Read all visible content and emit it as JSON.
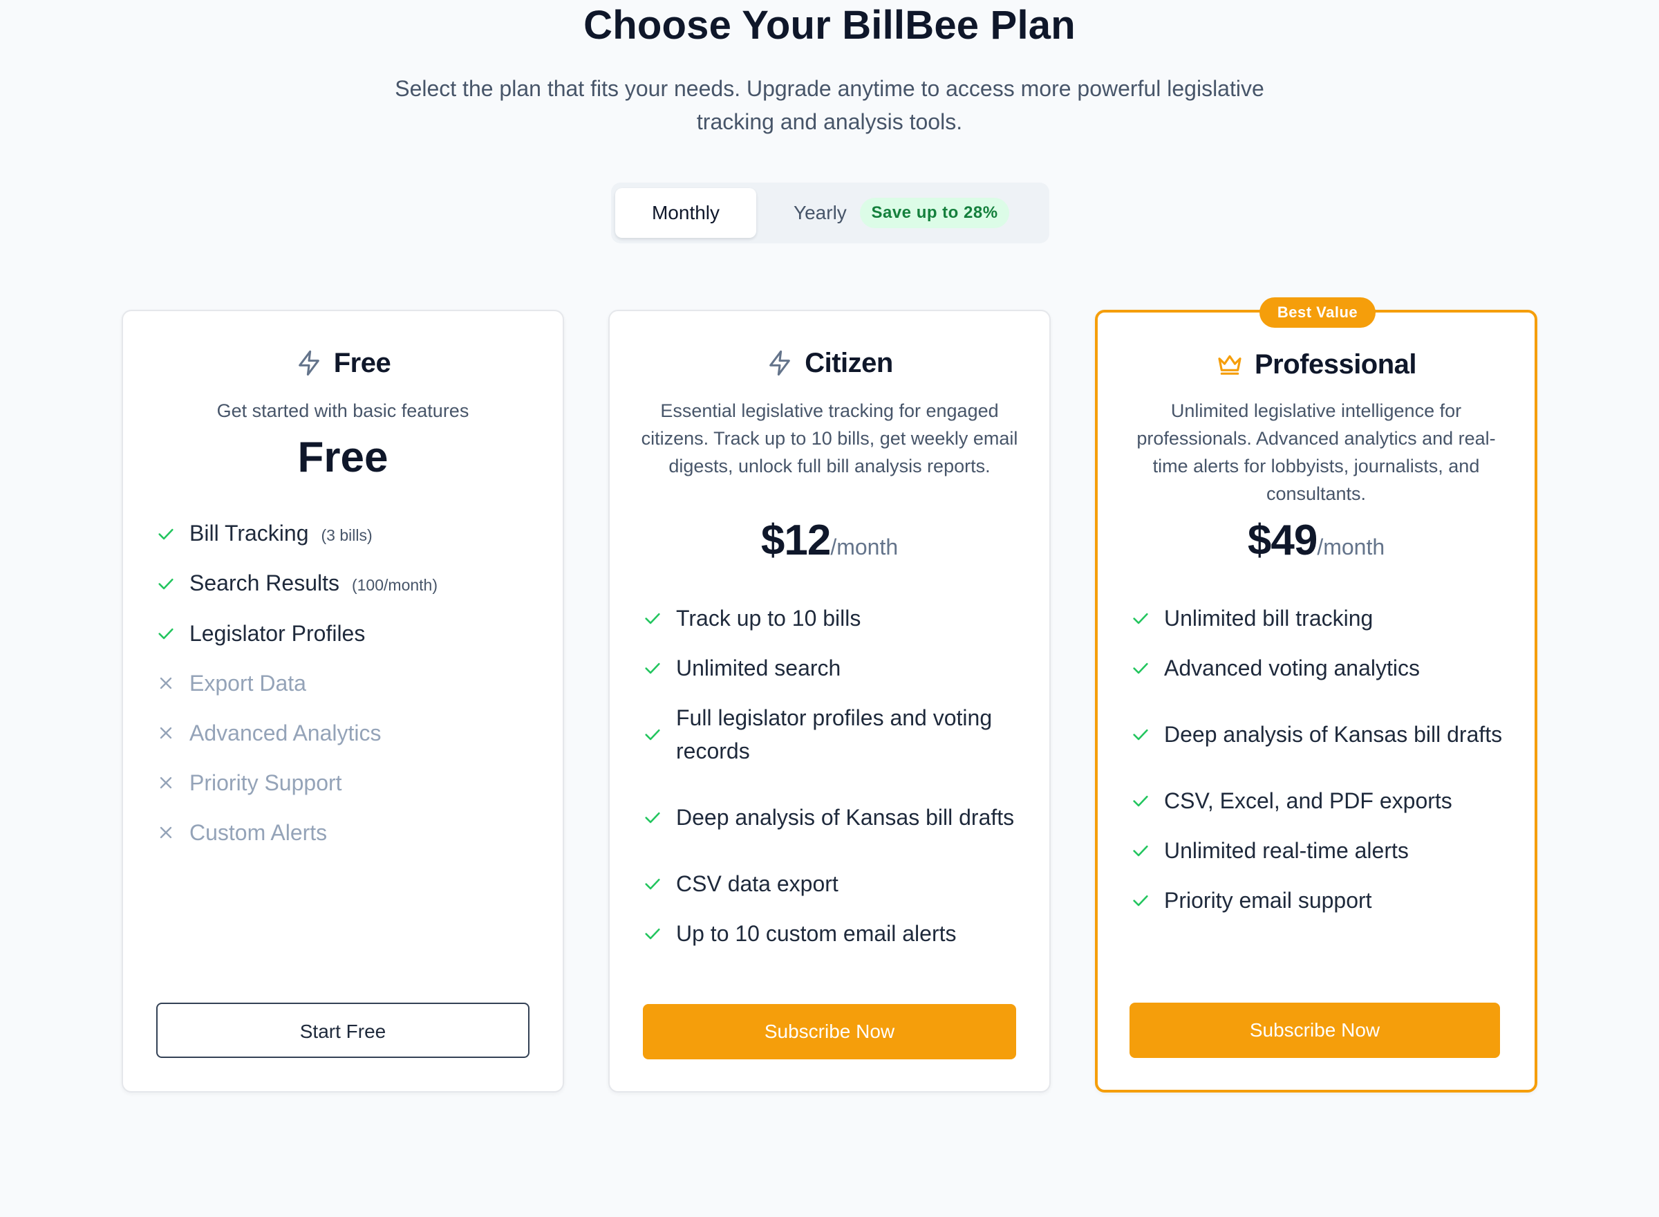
{
  "header": {
    "title": "Choose Your BillBee Plan",
    "subtitle": "Select the plan that fits your needs. Upgrade anytime to access more powerful legislative tracking and analysis tools."
  },
  "billing_toggle": {
    "monthly_label": "Monthly",
    "yearly_label": "Yearly",
    "save_badge": "Save up to 28%",
    "selected": "Monthly"
  },
  "colors": {
    "accent": "#f59e0b",
    "check": "#22c55e",
    "cross": "#94a3b8",
    "save_badge_bg": "#dcfce7",
    "save_badge_text": "#15803d"
  },
  "plans": [
    {
      "name": "Free",
      "icon": "lightning-icon",
      "description": "Get started with basic features",
      "price": "Free",
      "features": [
        {
          "label": "Bill Tracking",
          "note": "(3 bills)",
          "included": true
        },
        {
          "label": "Search Results",
          "note": "(100/month)",
          "included": true
        },
        {
          "label": "Legislator Profiles",
          "included": true
        },
        {
          "label": "Export Data",
          "included": false
        },
        {
          "label": "Advanced Analytics",
          "included": false
        },
        {
          "label": "Priority Support",
          "included": false
        },
        {
          "label": "Custom Alerts",
          "included": false
        }
      ],
      "button": "Start Free"
    },
    {
      "name": "Citizen",
      "icon": "lightning-icon",
      "description": "Essential legislative tracking for engaged citizens. Track up to 10 bills, get weekly email digests, unlock full bill analysis reports.",
      "price": "$12",
      "period": "/month",
      "features": [
        {
          "label": "Track up to 10 bills",
          "included": true
        },
        {
          "label": "Unlimited search",
          "included": true
        },
        {
          "label": "Full legislator profiles and voting records",
          "included": true
        },
        {
          "label": "Deep analysis of Kansas bill drafts",
          "included": true
        },
        {
          "label": "CSV data export",
          "included": true
        },
        {
          "label": "Up to 10 custom email alerts",
          "included": true
        }
      ],
      "button": "Subscribe Now"
    },
    {
      "name": "Professional",
      "icon": "crown-icon",
      "badge": "Best Value",
      "description": "Unlimited legislative intelligence for professionals. Advanced analytics and real-time alerts for lobbyists, journalists, and consultants.",
      "price": "$49",
      "period": "/month",
      "features": [
        {
          "label": "Unlimited bill tracking",
          "included": true
        },
        {
          "label": "Advanced voting analytics",
          "included": true
        },
        {
          "label": "Deep analysis of Kansas bill drafts",
          "included": true
        },
        {
          "label": "CSV, Excel, and PDF exports",
          "included": true
        },
        {
          "label": "Unlimited real-time alerts",
          "included": true
        },
        {
          "label": "Priority email support",
          "included": true
        }
      ],
      "button": "Subscribe Now"
    }
  ]
}
